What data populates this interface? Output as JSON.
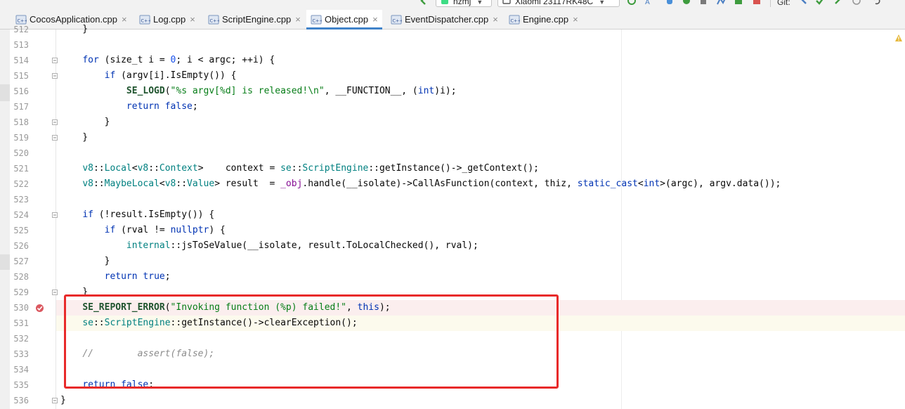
{
  "toolbar": {
    "config_combo": "nzmj",
    "device_combo": "Xiaomi 23117RK48C",
    "git_label": "Git:"
  },
  "tabs": [
    {
      "label": "CocosApplication.cpp",
      "active": false
    },
    {
      "label": "Log.cpp",
      "active": false
    },
    {
      "label": "ScriptEngine.cpp",
      "active": false
    },
    {
      "label": "Object.cpp",
      "active": true
    },
    {
      "label": "EventDispatcher.cpp",
      "active": false
    },
    {
      "label": "Engine.cpp",
      "active": false
    }
  ],
  "editor": {
    "highlight_colors": {
      "breakpoint_line": "#fbeeee",
      "current_line": "#fcfaed",
      "annotation_box": "#e82a2a"
    },
    "lines": [
      {
        "num": "512",
        "text": "    }"
      },
      {
        "num": "513",
        "text": ""
      },
      {
        "num": "514",
        "text": "    for (size_t i = 0; i < argc; ++i) {"
      },
      {
        "num": "515",
        "text": "        if (argv[i].IsEmpty()) {"
      },
      {
        "num": "516",
        "text": "            SE_LOGD(\"%s argv[%d] is released!\\n\", __FUNCTION__, (int)i);"
      },
      {
        "num": "517",
        "text": "            return false;"
      },
      {
        "num": "518",
        "text": "        }"
      },
      {
        "num": "519",
        "text": "    }"
      },
      {
        "num": "520",
        "text": ""
      },
      {
        "num": "521",
        "text": "    v8::Local<v8::Context>    context = se::ScriptEngine::getInstance()->_getContext();"
      },
      {
        "num": "522",
        "text": "    v8::MaybeLocal<v8::Value> result  = _obj.handle(__isolate)->CallAsFunction(context, thiz, static_cast<int>(argc), argv.data());"
      },
      {
        "num": "523",
        "text": ""
      },
      {
        "num": "524",
        "text": "    if (!result.IsEmpty()) {"
      },
      {
        "num": "525",
        "text": "        if (rval != nullptr) {"
      },
      {
        "num": "526",
        "text": "            internal::jsToSeValue(__isolate, result.ToLocalChecked(), rval);"
      },
      {
        "num": "527",
        "text": "        }"
      },
      {
        "num": "528",
        "text": "        return true;"
      },
      {
        "num": "529",
        "text": "    }"
      },
      {
        "num": "530",
        "text": "    SE_REPORT_ERROR(\"Invoking function (%p) failed!\", this);"
      },
      {
        "num": "531",
        "text": "    se::ScriptEngine::getInstance()->clearException();"
      },
      {
        "num": "532",
        "text": ""
      },
      {
        "num": "533",
        "text": "    //        assert(false);"
      },
      {
        "num": "534",
        "text": ""
      },
      {
        "num": "535",
        "text": "    return false;"
      },
      {
        "num": "536",
        "text": "}"
      }
    ]
  }
}
